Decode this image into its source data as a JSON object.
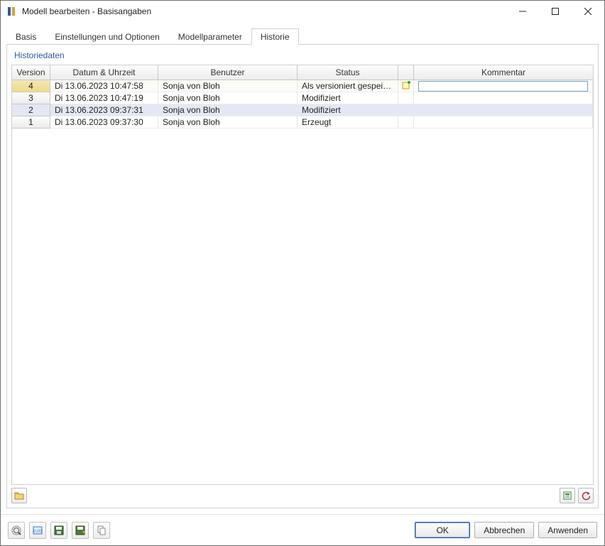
{
  "window": {
    "title": "Modell bearbeiten - Basisangaben"
  },
  "tabs": {
    "basis": "Basis",
    "einstellungen": "Einstellungen und Optionen",
    "modellparameter": "Modellparameter",
    "historie": "Historie"
  },
  "section_label": "Historiedaten",
  "columns": {
    "version": "Version",
    "datum": "Datum & Uhrzeit",
    "benutzer": "Benutzer",
    "status": "Status",
    "kommentar": "Kommentar"
  },
  "rows": [
    {
      "version": "4",
      "datum": "Di 13.06.2023 10:47:58",
      "benutzer": "Sonja von Bloh",
      "status": "Als versioniert gespeich...",
      "kommentar": "",
      "editable": true,
      "note": true
    },
    {
      "version": "3",
      "datum": "Di 13.06.2023 10:47:19",
      "benutzer": "Sonja von Bloh",
      "status": "Modifiziert",
      "kommentar": ""
    },
    {
      "version": "2",
      "datum": "Di 13.06.2023 09:37:31",
      "benutzer": "Sonja von Bloh",
      "status": "Modifiziert",
      "kommentar": ""
    },
    {
      "version": "1",
      "datum": "Di 13.06.2023 09:37:30",
      "benutzer": "Sonja von Bloh",
      "status": "Erzeugt",
      "kommentar": ""
    }
  ],
  "footer_buttons": {
    "ok": "OK",
    "cancel": "Abbrechen",
    "apply": "Anwenden"
  }
}
